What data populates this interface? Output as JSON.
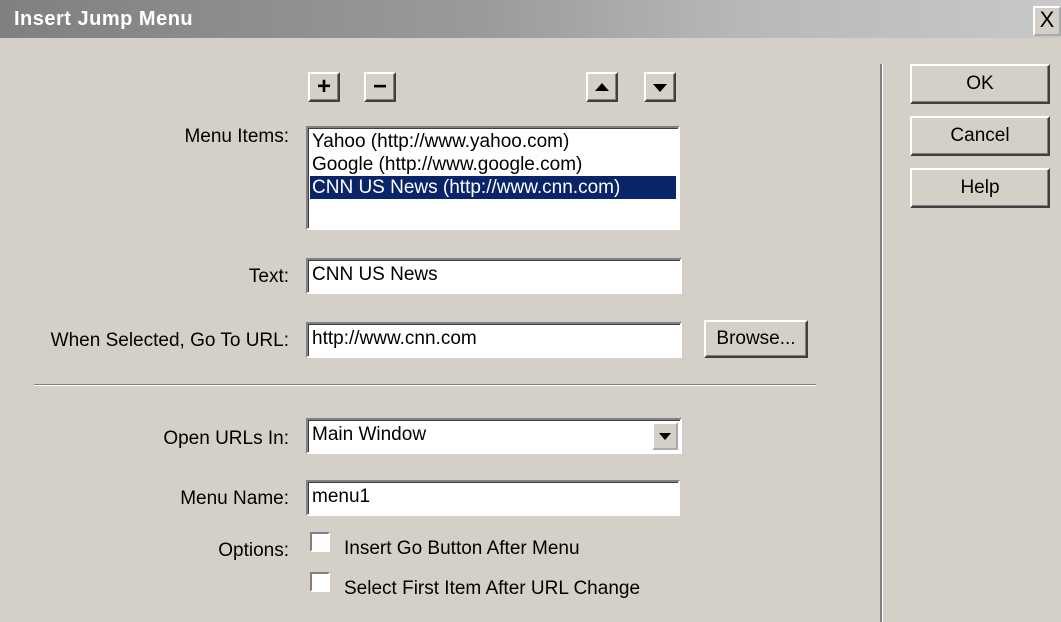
{
  "window": {
    "title": "Insert Jump Menu",
    "close_label": "X"
  },
  "buttons": {
    "ok": "OK",
    "cancel": "Cancel",
    "help": "Help",
    "browse": "Browse...",
    "add": "+",
    "remove": "−"
  },
  "menu_items": {
    "label": "Menu Items:",
    "items": [
      "Yahoo (http://www.yahoo.com)",
      "Google (http://www.google.com)",
      "CNN US News (http://www.cnn.com)"
    ],
    "selected_index": 2
  },
  "text_field": {
    "label": "Text:",
    "value": "CNN US News"
  },
  "url_field": {
    "label": "When Selected, Go To URL:",
    "value": "http://www.cnn.com"
  },
  "open_urls": {
    "label": "Open URLs In:",
    "value": "Main Window"
  },
  "menu_name": {
    "label": "Menu Name:",
    "value": "menu1"
  },
  "options": {
    "label": "Options:",
    "insert_go_button": {
      "label": "Insert Go Button After Menu",
      "checked": false
    },
    "select_first_item": {
      "label": "Select First Item After URL Change",
      "checked": false
    }
  },
  "colors": {
    "dialog_bg": "#d4d0c8",
    "selection": "#0a246a"
  }
}
